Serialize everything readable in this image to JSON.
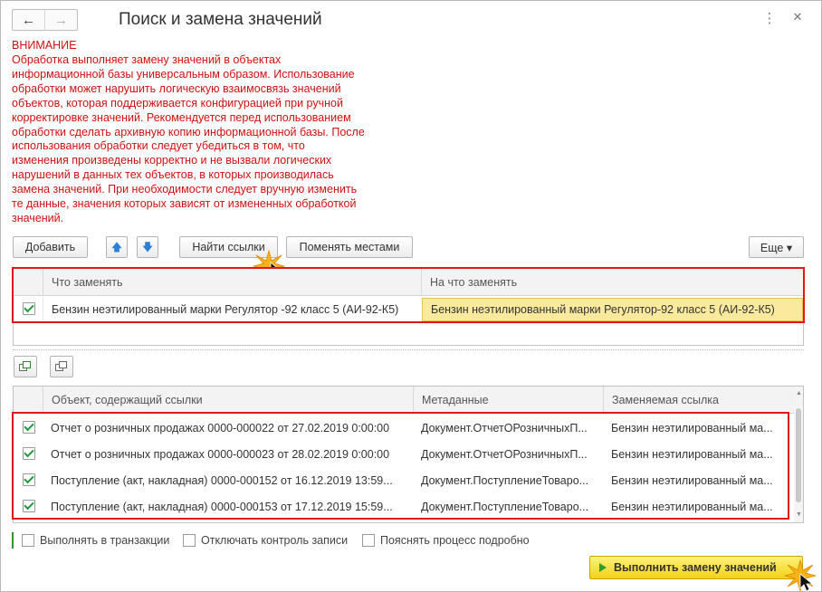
{
  "window": {
    "title": "Поиск и замена значений",
    "back_icon": "←",
    "forward_icon": "→",
    "more_icon": "⋮",
    "close_icon": "✕"
  },
  "warning": {
    "heading": "ВНИМАНИЕ",
    "text": "Обработка выполняет замену значений в объектах\nинформационной базы универсальным образом.  Использование\nобработки может нарушить логическую взаимосвязь значений\nобъектов, которая поддерживается конфигурацией при ручной\nкорректировке значений. Рекомендуется перед использованием\nобработки сделать архивную копию информационной базы. После\nиспользования обработки следует убедиться в том, что\nизменения произведены корректно и не вызвали логических\nнарушений в данных тех объектов, в которых производилась\nзамена значений. При необходимости следует вручную изменить\nте данные, значения которых зависят от измененных обработкой\nзначений."
  },
  "toolbar": {
    "add_label": "Добавить",
    "up_icon": "🡅",
    "down_icon": "🡇",
    "find_refs_label": "Найти ссылки",
    "swap_label": "Поменять местами",
    "more_label": "Еще ▾"
  },
  "replace_table": {
    "columns": [
      "Что заменять",
      "На что заменять"
    ],
    "rows": [
      {
        "checked": true,
        "what": "Бензин неэтилированный марки Регулятор -92 класс 5 (АИ-92-К5)",
        "with": "Бензин неэтилированный марки Регулятор-92 класс 5 (АИ-92-К5)"
      }
    ]
  },
  "refs_table": {
    "columns": [
      "Объект, содержащий ссылки",
      "Метаданные",
      "Заменяемая ссылка"
    ],
    "rows": [
      {
        "checked": true,
        "object": "Отчет о розничных продажах 0000-000022 от 27.02.2019 0:00:00",
        "meta": "Документ.ОтчетОРозничныхП...",
        "ref": "Бензин неэтилированный ма..."
      },
      {
        "checked": true,
        "object": "Отчет о розничных продажах 0000-000023 от 28.02.2019 0:00:00",
        "meta": "Документ.ОтчетОРозничныхП...",
        "ref": "Бензин неэтилированный ма..."
      },
      {
        "checked": true,
        "object": "Поступление (акт, накладная) 0000-000152 от 16.12.2019 13:59...",
        "meta": "Документ.ПоступлениеТоваро...",
        "ref": "Бензин неэтилированный ма..."
      },
      {
        "checked": true,
        "object": "Поступление (акт, накладная) 0000-000153 от 17.12.2019 15:59...",
        "meta": "Документ.ПоступлениеТоваро...",
        "ref": "Бензин неэтилированный ма..."
      }
    ]
  },
  "options": {
    "transaction": "Выполнять в транзакции",
    "disable_control": "Отключать контроль записи",
    "explain": "Пояснять процесс подробно"
  },
  "execute": {
    "label": "Выполнить замену значений"
  },
  "colors": {
    "warning": "#d01010",
    "highlight_frame": "#e0161b",
    "execute_button": "#f2d21a"
  }
}
